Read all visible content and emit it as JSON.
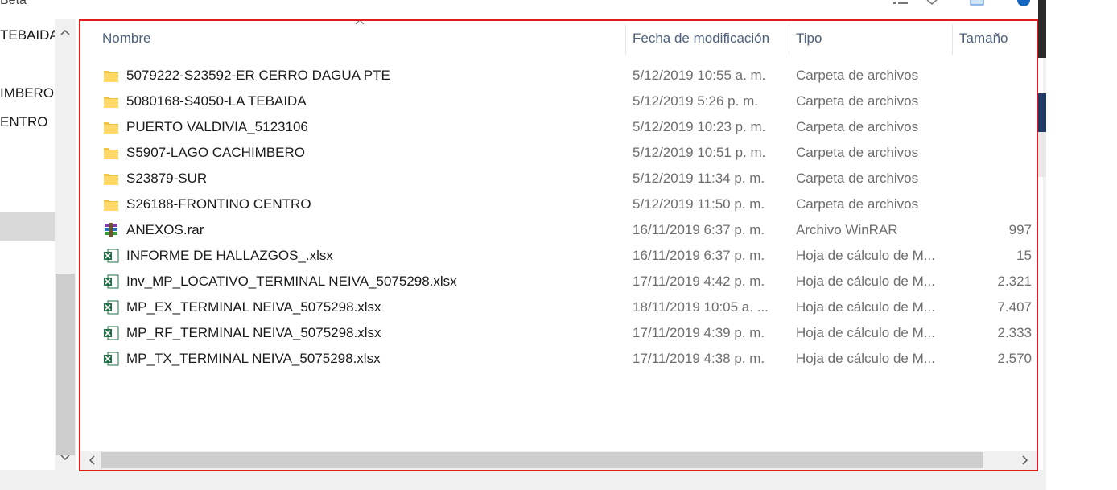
{
  "top_left_text": "Beta",
  "nav": {
    "items": [
      "TEBAIDA",
      "IMBERO",
      "ENTRO"
    ]
  },
  "columns": {
    "name": "Nombre",
    "date": "Fecha de modificación",
    "type": "Tipo",
    "size": "Tamaño"
  },
  "files": [
    {
      "icon": "folder-icon",
      "name": "5079222-S23592-ER CERRO DAGUA PTE",
      "date": "5/12/2019 10:55 a. m.",
      "type": "Carpeta de archivos",
      "size": ""
    },
    {
      "icon": "folder-icon",
      "name": "5080168-S4050-LA TEBAIDA",
      "date": "5/12/2019 5:26 p. m.",
      "type": "Carpeta de archivos",
      "size": ""
    },
    {
      "icon": "folder-icon",
      "name": "PUERTO VALDIVIA_5123106",
      "date": "5/12/2019 10:23 p. m.",
      "type": "Carpeta de archivos",
      "size": ""
    },
    {
      "icon": "folder-icon",
      "name": "S5907-LAGO CACHIMBERO",
      "date": "5/12/2019 10:51 p. m.",
      "type": "Carpeta de archivos",
      "size": ""
    },
    {
      "icon": "folder-icon",
      "name": "S23879-SUR",
      "date": "5/12/2019 11:34 p. m.",
      "type": "Carpeta de archivos",
      "size": ""
    },
    {
      "icon": "folder-icon",
      "name": "S26188-FRONTINO CENTRO",
      "date": "5/12/2019 11:50 p. m.",
      "type": "Carpeta de archivos",
      "size": ""
    },
    {
      "icon": "winrar-icon",
      "name": "ANEXOS.rar",
      "date": "16/11/2019 6:37 p. m.",
      "type": "Archivo WinRAR",
      "size": "997"
    },
    {
      "icon": "excel-icon",
      "name": "INFORME DE HALLAZGOS_.xlsx",
      "date": "16/11/2019 6:37 p. m.",
      "type": "Hoja de cálculo de M...",
      "size": "15"
    },
    {
      "icon": "excel-icon",
      "name": "Inv_MP_LOCATIVO_TERMINAL NEIVA_5075298.xlsx",
      "date": "17/11/2019 4:42 p. m.",
      "type": "Hoja de cálculo de M...",
      "size": "2.321"
    },
    {
      "icon": "excel-icon",
      "name": "MP_EX_TERMINAL NEIVA_5075298.xlsx",
      "date": "18/11/2019 10:05 a. ...",
      "type": "Hoja de cálculo de M...",
      "size": "7.407"
    },
    {
      "icon": "excel-icon",
      "name": "MP_RF_TERMINAL NEIVA_5075298.xlsx",
      "date": "17/11/2019 4:39 p. m.",
      "type": "Hoja de cálculo de M...",
      "size": "2.333"
    },
    {
      "icon": "excel-icon",
      "name": "MP_TX_TERMINAL NEIVA_5075298.xlsx",
      "date": "17/11/2019 4:38 p. m.",
      "type": "Hoja de cálculo de M...",
      "size": "2.570"
    }
  ],
  "colors": {
    "highlight_border": "#e11b1b",
    "header_text": "#4c607a",
    "folder": "#f5c242",
    "excel": "#1e7145"
  }
}
